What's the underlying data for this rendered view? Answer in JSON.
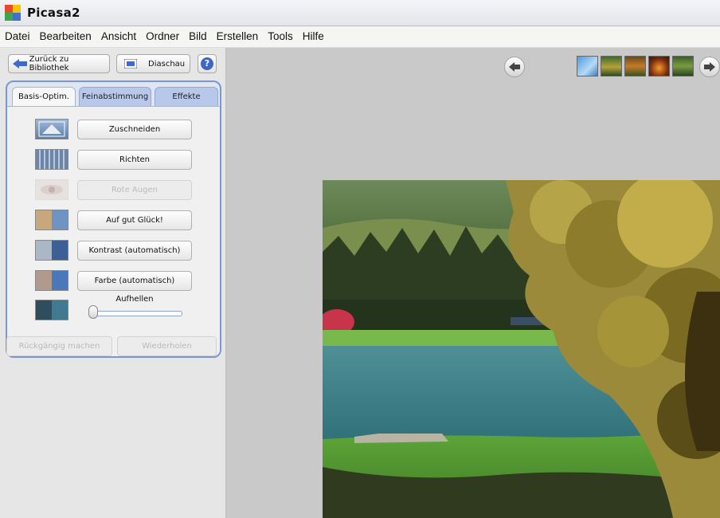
{
  "window": {
    "title": "Picasa2",
    "logo_icon": "picasa-logo-icon"
  },
  "menu": [
    "Datei",
    "Bearbeiten",
    "Ansicht",
    "Ordner",
    "Bild",
    "Erstellen",
    "Tools",
    "Hilfe"
  ],
  "toolbar": {
    "back_label": "Zurück zu Bibliothek",
    "slideshow_label": "Diaschau",
    "help_label": "?"
  },
  "tabs": [
    {
      "label": "Basis-Optim.",
      "active": true
    },
    {
      "label": "Feinabstimmung",
      "active": false
    },
    {
      "label": "Effekte",
      "active": false
    }
  ],
  "tools": [
    {
      "label": "Zuschneiden",
      "enabled": true
    },
    {
      "label": "Richten",
      "enabled": true
    },
    {
      "label": "Rote Augen",
      "enabled": false
    },
    {
      "label": "Auf gut Glück!",
      "enabled": true
    },
    {
      "label": "Kontrast (automatisch)",
      "enabled": true
    },
    {
      "label": "Farbe (automatisch)",
      "enabled": true
    }
  ],
  "slider": {
    "label": "Aufhellen",
    "value": 0
  },
  "bottom_buttons": {
    "undo": "Rückgängig machen",
    "redo": "Wiederholen"
  },
  "colors": {
    "tab_border": "#7896d8",
    "tab_inactive": "#b7c8ea",
    "accent_blue": "#3f66c4"
  }
}
